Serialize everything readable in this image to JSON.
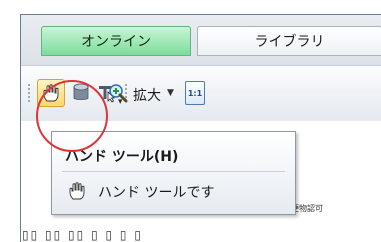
{
  "tabs": [
    {
      "label": "オンライン",
      "active": true
    },
    {
      "label": "ライブラリ",
      "active": false
    }
  ],
  "toolbar": {
    "hand_tool": {
      "icon": "hand-icon",
      "active": true
    },
    "cylinder_tool": {
      "icon": "cylinder-icon"
    },
    "select_tool": {
      "icon": "text-select-icon"
    },
    "zoom": {
      "icon": "magnifier-plus-icon",
      "label": "拡大"
    },
    "fit": {
      "icon": "fit-page-icon",
      "label": "1:1"
    }
  },
  "tooltip": {
    "title": "ハンド ツール(H)",
    "body": "ハンド ツールです",
    "icon": "hand-icon"
  },
  "background": {
    "text_fragment": "郵便物認可"
  },
  "colors": {
    "active_tab": "#7ddc9b",
    "annotation": "#e0343a"
  }
}
